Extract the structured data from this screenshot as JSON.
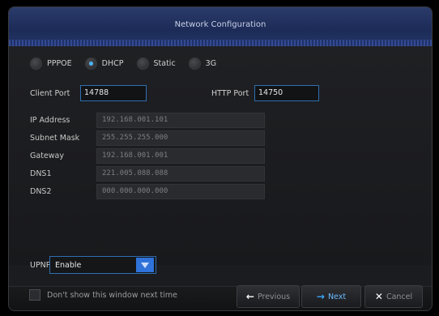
{
  "window": {
    "title": "Network Configuration"
  },
  "network_modes": [
    {
      "label": "PPPOE",
      "selected": false
    },
    {
      "label": "DHCP",
      "selected": true
    },
    {
      "label": "Static",
      "selected": false
    },
    {
      "label": "3G",
      "selected": false
    }
  ],
  "ports": {
    "client_label": "Client Port",
    "client_value": "14788",
    "http_label": "HTTP Port",
    "http_value": "14750"
  },
  "fields": [
    {
      "label": "IP Address",
      "value": "192.168.001.101"
    },
    {
      "label": "Subnet Mask",
      "value": "255.255.255.000"
    },
    {
      "label": "Gateway",
      "value": "192.168.001.001"
    },
    {
      "label": "DNS1",
      "value": "221.005.088.088"
    },
    {
      "label": "DNS2",
      "value": "000.000.000.000"
    }
  ],
  "upnp": {
    "label": "UPNP",
    "value": "Enable"
  },
  "footer": {
    "checkbox_label": "Don't show this window next time",
    "previous_label": "Previous",
    "next_label": "Next",
    "cancel_label": "Cancel"
  },
  "colors": {
    "accent": "#2f72d9",
    "title_bar": "#1c2b57",
    "selected_dot": "#4db4ff"
  }
}
